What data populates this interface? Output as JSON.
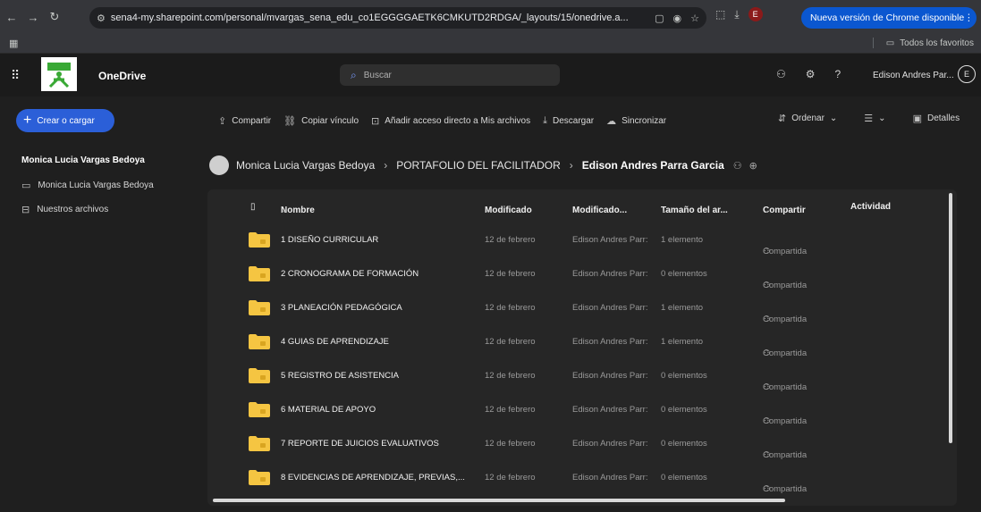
{
  "browser": {
    "url": "sena4-my.sharepoint.com/personal/mvargas_sena_edu_co1EGGGGAETK6CMKUTD2RDGA/_layouts/15/onedrive.a...",
    "profile_initial": "E",
    "update_label": "Nueva versión de Chrome disponible",
    "bookmarks_label": "Todos los favoritos"
  },
  "header": {
    "app_name": "OneDrive",
    "search_placeholder": "Buscar",
    "user_name": "Edison Andres Par...",
    "avatar_initial": "E"
  },
  "left_pane": {
    "create_label": "Crear o cargar",
    "title": "Monica Lucia Vargas Bedoya",
    "items": [
      {
        "label": "Monica Lucia Vargas Bedoya",
        "icon": "folder-outline-icon"
      },
      {
        "label": "Nuestros archivos",
        "icon": "shared-files-icon"
      }
    ]
  },
  "command_bar": {
    "share": "Compartir",
    "copy_link": "Copiar vínculo",
    "add_shortcut": "Añadir acceso directo a Mis archivos",
    "download": "Descargar",
    "sync": "Sincronizar",
    "sort": "Ordenar",
    "details": "Detalles"
  },
  "breadcrumb": {
    "items": [
      "Monica Lucia Vargas Bedoya",
      "PORTAFOLIO DEL FACILITADOR"
    ],
    "current": "Edison Andres Parra Garcia"
  },
  "columns": {
    "name": "Nombre",
    "modified": "Modificado",
    "modified_by": "Modificado...",
    "size": "Tamaño del ar...",
    "sharing": "Compartir",
    "activity": "Actividad"
  },
  "rows": [
    {
      "name": "1 DISEÑO CURRICULAR",
      "modified": "12 de febrero",
      "modified_by": "Edison Andres Parr:",
      "size": "1 elemento",
      "sharing": "Compartida"
    },
    {
      "name": "2 CRONOGRAMA DE FORMACIÓN",
      "modified": "12 de febrero",
      "modified_by": "Edison Andres Parr:",
      "size": "0 elementos",
      "sharing": "Compartida"
    },
    {
      "name": "3 PLANEACIÓN PEDAGÓGICA",
      "modified": "12 de febrero",
      "modified_by": "Edison Andres Parr:",
      "size": "1 elemento",
      "sharing": "Compartida"
    },
    {
      "name": "4 GUIAS DE APRENDIZAJE",
      "modified": "12 de febrero",
      "modified_by": "Edison Andres Parr:",
      "size": "1 elemento",
      "sharing": "Compartida"
    },
    {
      "name": "5 REGISTRO DE ASISTENCIA",
      "modified": "12 de febrero",
      "modified_by": "Edison Andres Parr:",
      "size": "0 elementos",
      "sharing": "Compartida"
    },
    {
      "name": "6 MATERIAL DE APOYO",
      "modified": "12 de febrero",
      "modified_by": "Edison Andres Parr:",
      "size": "0 elementos",
      "sharing": "Compartida"
    },
    {
      "name": "7 REPORTE DE JUICIOS EVALUATIVOS",
      "modified": "12 de febrero",
      "modified_by": "Edison Andres Parr:",
      "size": "0 elementos",
      "sharing": "Compartida"
    },
    {
      "name": "8 EVIDENCIAS DE APRENDIZAJE, PREVIAS,...",
      "modified": "12 de febrero",
      "modified_by": "Edison Andres Parr:",
      "size": "0 elementos",
      "sharing": "Compartida"
    }
  ],
  "colors": {
    "accent": "#2b5fd8",
    "folder": "#f5c542",
    "update_pill": "#0b57d0"
  }
}
